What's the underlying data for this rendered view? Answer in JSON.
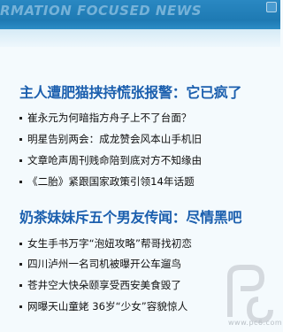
{
  "banner": {
    "text": "RMATION FOCUSED NEWS"
  },
  "sections": [
    {
      "title": "主人遭肥猫挟持慌张报警：它已疯了",
      "items": [
        "崔永元为何暗指方舟子上不了台面？",
        "明星告别两会：成龙赞会风本山手机旧",
        "文章呛声周刊贱命陪到底对方不知缘由",
        "《二胎》紧跟国家政策引领14年话题"
      ]
    },
    {
      "title": "奶茶妹妹斥五个男友传闻：尽情黑吧",
      "items": [
        "女生手书万字“泡妞攻略”帮哥找初恋",
        "四川泸州一名司机被曝开公车遛鸟",
        "苍井空大快朵颐享受西安美食毁了",
        "网曝天山童姥 36岁“少女”容貌惊人"
      ]
    }
  ],
  "watermark": {
    "text": "www.pc6.com"
  }
}
